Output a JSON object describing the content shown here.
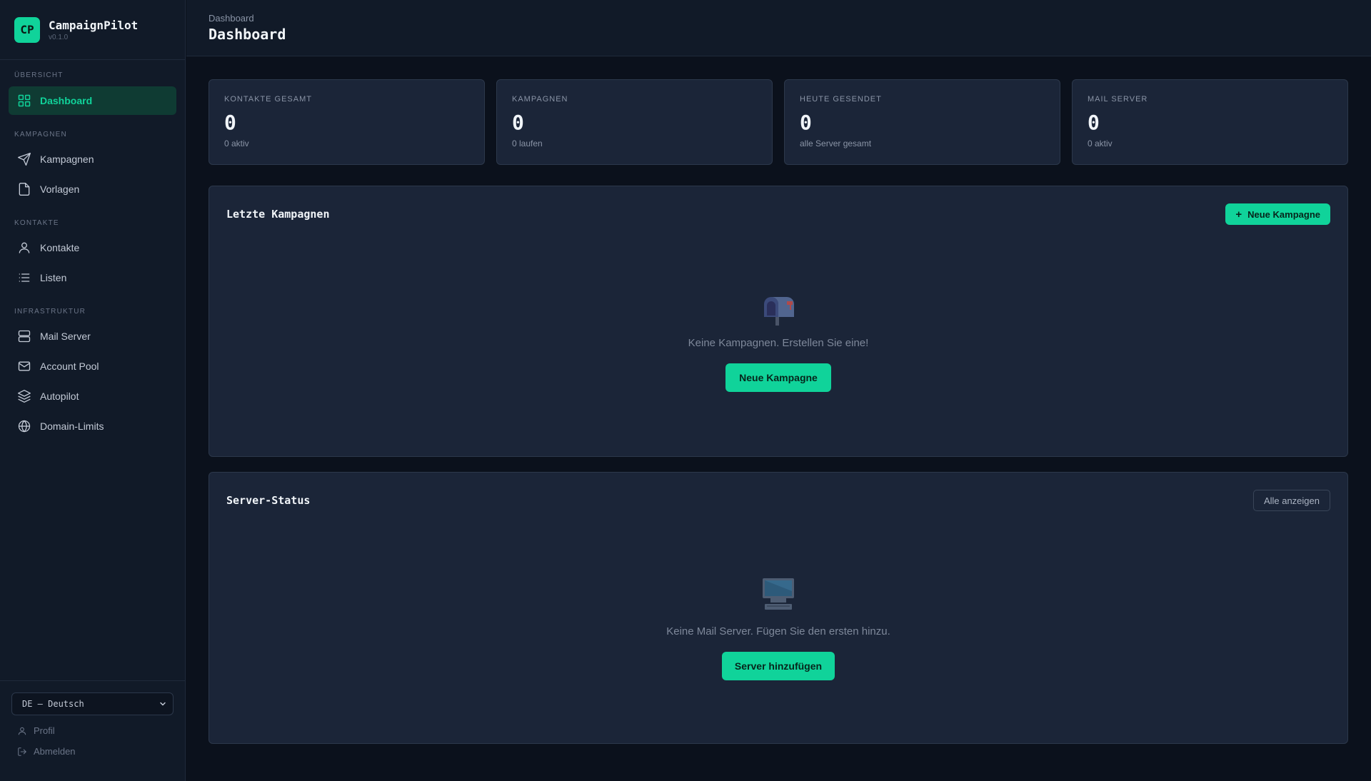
{
  "brand": {
    "logo": "CP",
    "name": "CampaignPilot",
    "version": "v0.1.0"
  },
  "nav": {
    "sections": {
      "overview": "ÜBERSICHT",
      "campaigns": "KAMPAGNEN",
      "contacts": "KONTAKTE",
      "infrastructure": "INFRASTRUKTUR"
    },
    "items": {
      "dashboard": "Dashboard",
      "campaigns": "Kampagnen",
      "templates": "Vorlagen",
      "contacts": "Kontakte",
      "lists": "Listen",
      "mail_server": "Mail Server",
      "account_pool": "Account Pool",
      "autopilot": "Autopilot",
      "domain_limits": "Domain-Limits"
    },
    "icons": {
      "dashboard": "grid-icon",
      "campaigns": "send-icon",
      "templates": "file-icon",
      "contacts": "user-icon",
      "lists": "list-icon",
      "mail_server": "server-icon",
      "account_pool": "mail-icon",
      "autopilot": "layers-icon",
      "domain_limits": "globe-icon"
    },
    "active": "dashboard"
  },
  "footer": {
    "language_selected": "DE — Deutsch",
    "profile": "Profil",
    "logout": "Abmelden"
  },
  "header": {
    "breadcrumb": "Dashboard",
    "title": "Dashboard"
  },
  "stats": [
    {
      "label": "KONTAKTE GESAMT",
      "value": "0",
      "sub": "0 aktiv"
    },
    {
      "label": "KAMPAGNEN",
      "value": "0",
      "sub": "0 laufen"
    },
    {
      "label": "HEUTE GESENDET",
      "value": "0",
      "sub": "alle Server gesamt"
    },
    {
      "label": "MAIL SERVER",
      "value": "0",
      "sub": "0 aktiv"
    }
  ],
  "campaigns_panel": {
    "title": "Letzte Kampagnen",
    "new_button": "Neue Kampagne",
    "empty_icon": "mailbox-icon",
    "empty_text": "Keine Kampagnen. Erstellen Sie eine!",
    "empty_button": "Neue Kampagne"
  },
  "server_panel": {
    "title": "Server-Status",
    "show_all": "Alle anzeigen",
    "empty_icon": "computer-icon",
    "empty_text": "Keine Mail Server. Fügen Sie den ersten hinzu.",
    "empty_button": "Server hinzufügen"
  },
  "colors": {
    "accent": "#10d39a",
    "background": "#0b111c",
    "sidebar": "#111a28",
    "card": "#1b2538",
    "border": "#2c384b"
  }
}
